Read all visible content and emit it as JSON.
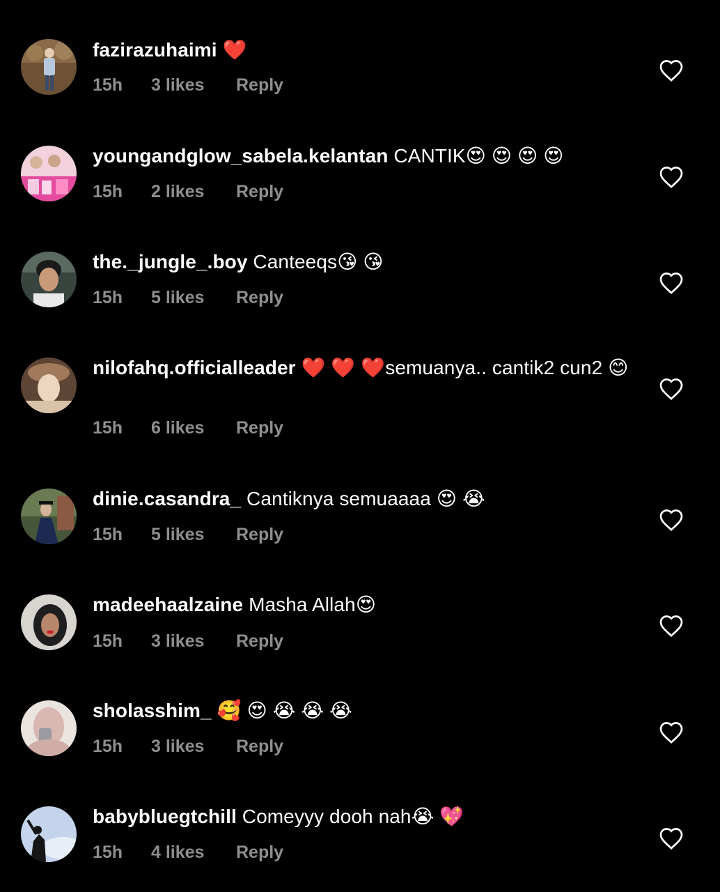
{
  "comments": [
    {
      "username": "fazirazuhaimi",
      "text": "❤️",
      "time": "15h",
      "likes": "3 likes",
      "reply": "Reply",
      "avatar": {
        "bg": "#7a5a3a",
        "accent": "#b0c4d8"
      }
    },
    {
      "username": "youngandglow_sabela.kelantan",
      "text": "CANTIK😍 😍 😍 😍",
      "time": "15h",
      "likes": "2 likes",
      "reply": "Reply",
      "avatar": {
        "bg": "#f3c6d6",
        "accent": "#e0409a"
      }
    },
    {
      "username": "the._jungle_.boy",
      "text": "Canteeqs😘 😘",
      "time": "15h",
      "likes": "5 likes",
      "reply": "Reply",
      "avatar": {
        "bg": "#3e4a44",
        "accent": "#c89a78"
      }
    },
    {
      "username": "nilofahq.officialleader",
      "text": "❤️ ❤️ ❤️semuanya.. cantik2 cun2 😊",
      "time": "15h",
      "likes": "6 likes",
      "reply": "Reply",
      "avatar": {
        "bg": "#6b4f3a",
        "accent": "#e8d3b6"
      }
    },
    {
      "username": "dinie.casandra_",
      "text": "Cantiknya semuaaaa 😍 😭",
      "time": "15h",
      "likes": "5 likes",
      "reply": "Reply",
      "avatar": {
        "bg": "#4a5a3e",
        "accent": "#1c2a52"
      }
    },
    {
      "username": "madeehaalzaine",
      "text": "Masha Allah😍",
      "time": "15h",
      "likes": "3 likes",
      "reply": "Reply",
      "avatar": {
        "bg": "#d8d4d0",
        "accent": "#2a2a2a"
      }
    },
    {
      "username": "sholasshim_",
      "text": "🥰 😍 😭 😭 😭",
      "time": "15h",
      "likes": "3 likes",
      "reply": "Reply",
      "avatar": {
        "bg": "#e8e2de",
        "accent": "#d6b4b0"
      }
    },
    {
      "username": "babybluegtchill",
      "text": "Comeyyy dooh nah😭 💖",
      "time": "15h",
      "likes": "4 likes",
      "reply": "Reply",
      "avatar": {
        "bg": "#c7d6ec",
        "accent": "#1a1a1a"
      }
    }
  ],
  "colors": {
    "background": "#000000",
    "primary_text": "#ffffff",
    "secondary_text": "#8e8e8e"
  },
  "icons": {
    "like": "heart-outline-icon"
  }
}
